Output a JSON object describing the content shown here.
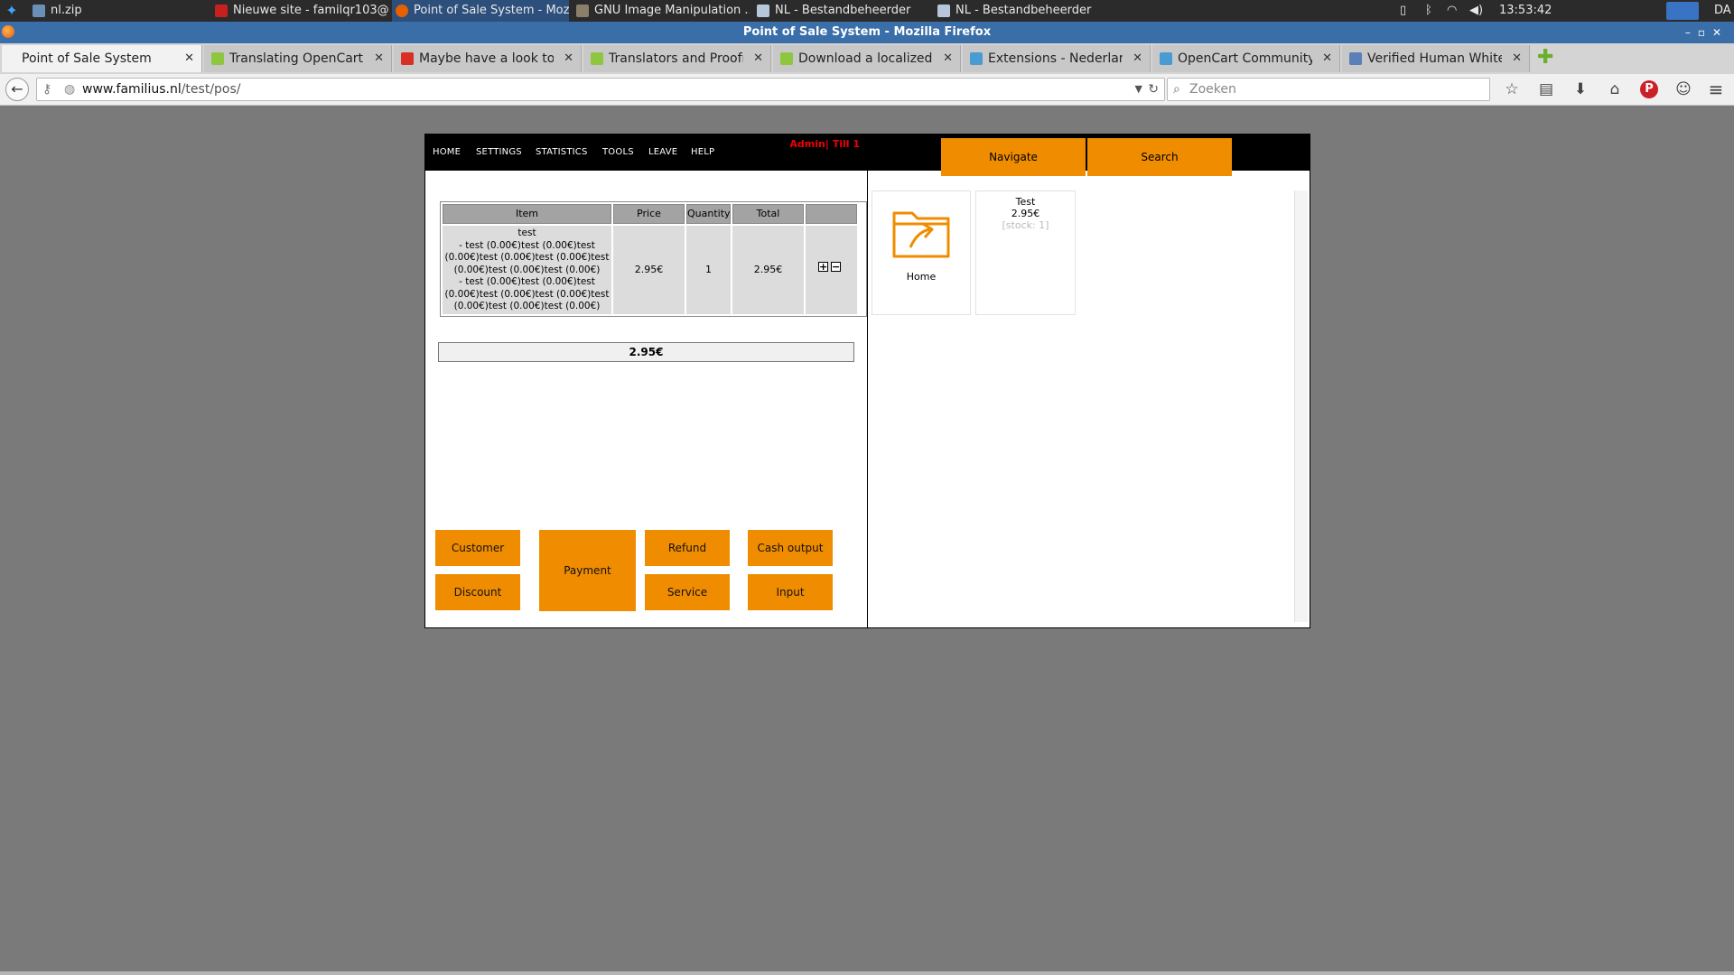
{
  "taskbar": {
    "tasks": [
      {
        "label": "nl.zip",
        "icon": "archive-icon"
      },
      {
        "label": "Nieuwe site - familqr103@...",
        "icon": "filezilla-icon"
      },
      {
        "label": "Point of Sale System - Moz...",
        "icon": "firefox-icon"
      },
      {
        "label": "GNU Image Manipulation ...",
        "icon": "gimp-icon"
      },
      {
        "label": "NL - Bestandbeheerder",
        "icon": "folder-icon"
      },
      {
        "label": "NL - Bestandbeheerder",
        "icon": "folder-icon"
      }
    ],
    "active_task": 2,
    "clock": "13:53:42",
    "user": "DA"
  },
  "window": {
    "title": "Point of Sale System - Mozilla Firefox"
  },
  "browser": {
    "tabs": [
      {
        "label": "Point of Sale System",
        "selected": true
      },
      {
        "label": "Translating OpenCart T...",
        "icon": "opencart-icon"
      },
      {
        "label": "Maybe have a look to t...",
        "icon": "gmail-icon"
      },
      {
        "label": "Translators and Proofre...",
        "icon": "opencart-icon"
      },
      {
        "label": "Download a localized p...",
        "icon": "opencart-icon"
      },
      {
        "label": "Extensions - Nederland...",
        "icon": "site-icon"
      },
      {
        "label": "OpenCart Community •...",
        "icon": "site-icon"
      },
      {
        "label": "Verified Human Whiteli...",
        "icon": "site-icon"
      }
    ],
    "url_host": "www.familius.nl",
    "url_path": "/test/pos/",
    "search_placeholder": "Zoeken"
  },
  "pos": {
    "menu": [
      "HOME",
      "SETTINGS",
      "STATISTICS",
      "TOOLS",
      "LEAVE",
      "HELP"
    ],
    "admin_label": "Admin| Till 1",
    "table_headers": {
      "item": "Item",
      "price": "Price",
      "quantity": "Quantity",
      "total": "Total",
      "actions": ""
    },
    "order_rows": [
      {
        "item": "test\n- test (0.00€)test (0.00€)test\n(0.00€)test (0.00€)test (0.00€)test\n(0.00€)test (0.00€)test (0.00€)\n- test (0.00€)test (0.00€)test\n(0.00€)test (0.00€)test (0.00€)test\n(0.00€)test (0.00€)test (0.00€)",
        "price": "2.95€",
        "quantity": "1",
        "total": "2.95€"
      }
    ],
    "grand_total": "2.95€",
    "buttons": {
      "customer": "Customer",
      "discount": "Discount",
      "payment": "Payment",
      "refund": "Refund",
      "service": "Service",
      "cash_output": "Cash output",
      "input": "Input"
    },
    "right_tabs": {
      "navigate": "Navigate",
      "search": "Search"
    },
    "tiles": [
      {
        "label": "Home",
        "icon": "folder-up-icon"
      },
      {
        "name": "Test",
        "price": "2.95€",
        "stock": "[stock: 1]"
      }
    ],
    "accent_color": "#f08c00"
  }
}
